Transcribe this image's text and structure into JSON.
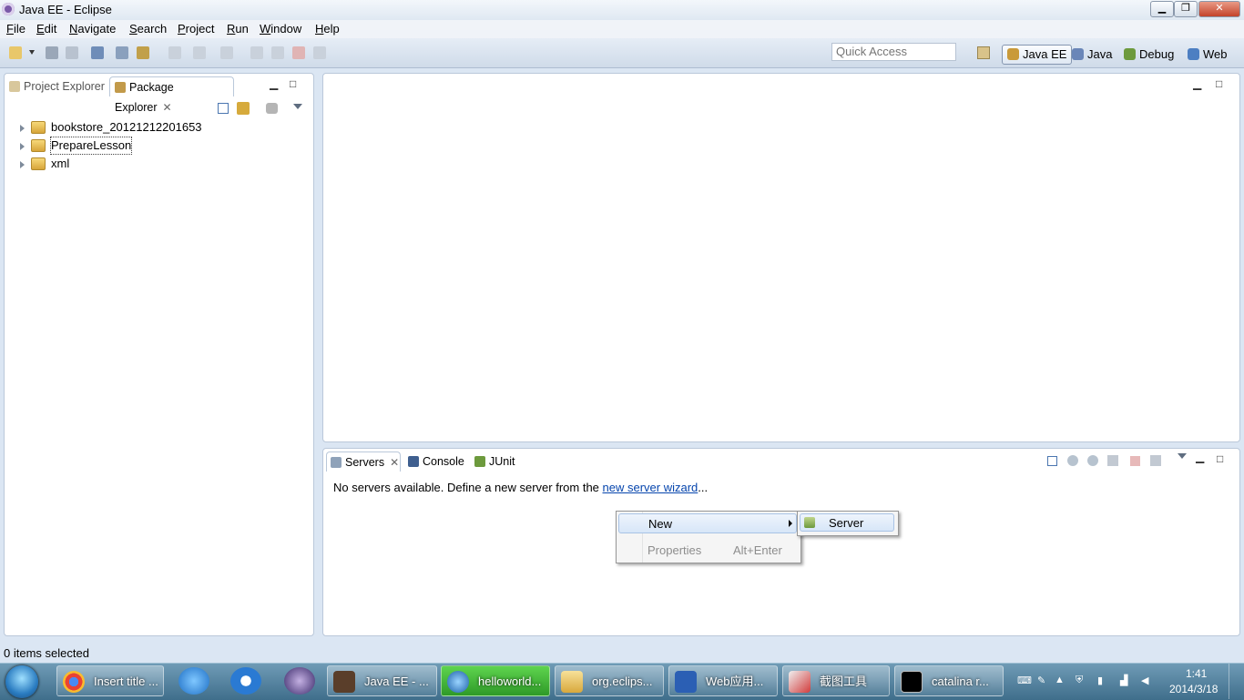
{
  "window": {
    "title": "Java EE - Eclipse",
    "controls": {
      "minimize": "▁",
      "restore": "❐",
      "close": "✕"
    }
  },
  "menu": [
    {
      "label": "File",
      "ul": "F",
      "rest": "ile"
    },
    {
      "label": "Edit",
      "ul": "E",
      "rest": "dit"
    },
    {
      "label": "Navigate",
      "ul": "N",
      "rest": "avigate"
    },
    {
      "label": "Search",
      "ul": "S",
      "rest": "earch"
    },
    {
      "label": "Project",
      "ul": "P",
      "rest": "roject"
    },
    {
      "label": "Run",
      "ul": "R",
      "rest": "un"
    },
    {
      "label": "Window",
      "ul": "W",
      "rest": "indow"
    },
    {
      "label": "Help",
      "ul": "H",
      "rest": "elp"
    }
  ],
  "toolbar": {
    "quick_access_placeholder": "Quick Access",
    "perspectives": [
      {
        "label": "Java EE",
        "icon": "java-ee-perspective-icon",
        "color": "#c99a3a"
      },
      {
        "label": "Java",
        "icon": "java-perspective-icon",
        "color": "#6a86b8"
      },
      {
        "label": "Debug",
        "icon": "debug-perspective-icon",
        "color": "#6d9a3d"
      },
      {
        "label": "Web",
        "icon": "web-perspective-icon",
        "color": "#4d7fc2"
      }
    ]
  },
  "left_panel": {
    "tabs": [
      {
        "label": "Project Explorer",
        "active": false
      },
      {
        "label": "Package Explorer",
        "active": true
      }
    ],
    "projects": [
      {
        "label": "bookstore_20121212201653"
      },
      {
        "label": "PrepareLesson"
      },
      {
        "label": "xml"
      }
    ]
  },
  "bottom_panel": {
    "tabs": [
      {
        "label": "Servers",
        "active": true
      },
      {
        "label": "Console",
        "active": false
      },
      {
        "label": "JUnit",
        "active": false
      }
    ],
    "message_prefix": "No servers available. Define a new server from the ",
    "message_link": "new server wizard",
    "message_suffix": "..."
  },
  "context_menu": {
    "new_label": "New",
    "properties_label": "Properties",
    "properties_accel": "Alt+Enter",
    "submenu_server": "Server"
  },
  "status": {
    "text": "0 items selected"
  },
  "taskbar": {
    "tasks": [
      {
        "label": "Insert title ...",
        "icon": "chrome-icon"
      },
      {
        "label": "Java EE - ...",
        "icon": "eclipse-icon"
      },
      {
        "label": "helloworld...",
        "icon": "video-icon"
      },
      {
        "label": "org.eclips...",
        "icon": "folder-icon"
      },
      {
        "label": "Web应用...",
        "icon": "word-icon"
      },
      {
        "label": "截图工具",
        "icon": "snipping-tool-icon"
      },
      {
        "label": "catalina  r...",
        "icon": "cmd-icon"
      }
    ],
    "clock_time": "1:41",
    "clock_date": "2014/3/18"
  }
}
